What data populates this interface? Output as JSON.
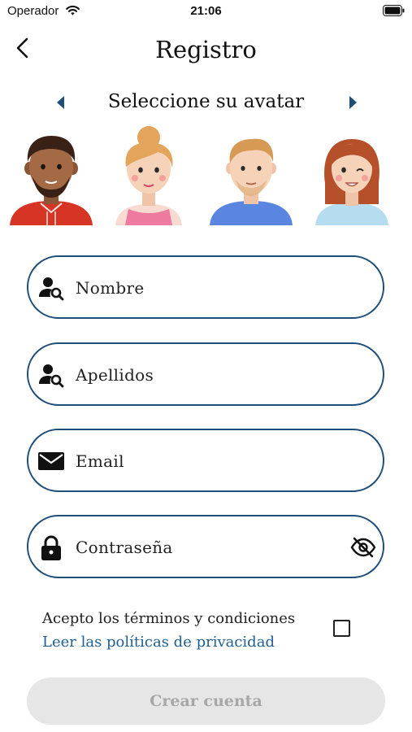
{
  "status_bar": {
    "carrier": "Operador",
    "time": "21:06"
  },
  "header": {
    "title": "Registro"
  },
  "avatar_picker": {
    "label": "Seleccione su avatar",
    "avatars": [
      "avatar-man-dark-hair",
      "avatar-woman-bun",
      "avatar-man-blond",
      "avatar-woman-red-hair"
    ]
  },
  "form": {
    "nombre_placeholder": "Nombre",
    "apellidos_placeholder": "Apellidos",
    "email_placeholder": "Email",
    "password_placeholder": "Contraseña"
  },
  "terms": {
    "accept_text": "Acepto los términos y condiciones",
    "privacy_link": "Leer las políticas de privacidad",
    "checked": false
  },
  "submit": {
    "label": "Crear cuenta",
    "enabled": false
  },
  "colors": {
    "accent": "#1f4e79",
    "link": "#1f5f94",
    "button_disabled": "#e6e6e6"
  }
}
